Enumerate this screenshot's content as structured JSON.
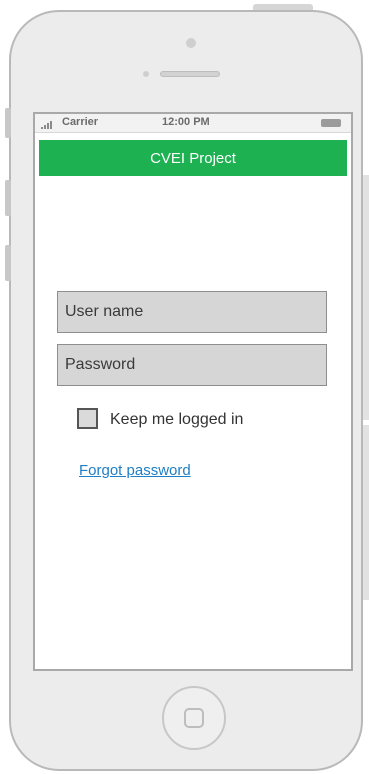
{
  "status_bar": {
    "carrier": "Carrier",
    "time": "12:00 PM"
  },
  "app": {
    "title": "CVEI Project"
  },
  "form": {
    "username_placeholder": "User name",
    "password_placeholder": "Password",
    "remember_label": "Keep me logged in",
    "remember_checked": false,
    "forgot_link": "Forgot password"
  },
  "colors": {
    "header_bg": "#1eb152",
    "link": "#1f7ec6"
  },
  "icons": {
    "status_signal": "signal-bars-icon",
    "status_battery": "battery-icon",
    "home": "home-button-icon"
  }
}
